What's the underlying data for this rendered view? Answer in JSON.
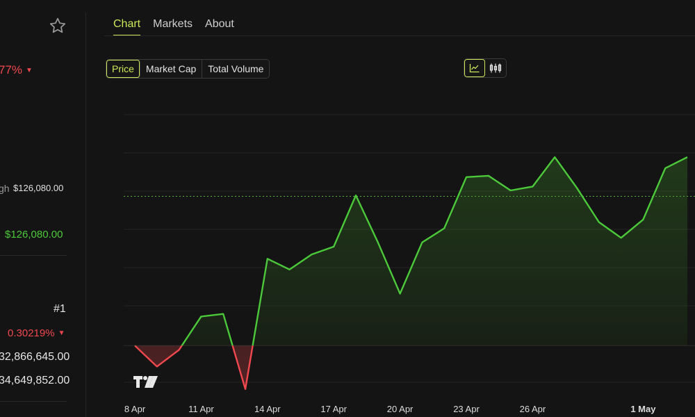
{
  "header": {
    "tabs": [
      {
        "label": "Chart",
        "active": true
      },
      {
        "label": "Markets",
        "active": false
      },
      {
        "label": "About",
        "active": false
      }
    ]
  },
  "controls": {
    "metric_tabs": [
      {
        "label": "Price",
        "active": true
      },
      {
        "label": "Market Cap",
        "active": false
      },
      {
        "label": "Total Volume",
        "active": false
      }
    ],
    "view_toggle": [
      {
        "icon": "line-chart-icon",
        "active": true
      },
      {
        "icon": "candlestick-icon",
        "active": false
      }
    ]
  },
  "left_panel": {
    "change_pct": "77%",
    "high_label": "gh",
    "high_value": "$126,080.00",
    "high_value_green": "$126,080.00",
    "rank": "#1",
    "dominance_pct": "0.30219%",
    "value_1": "32,866,645.00",
    "value_2": "34,649,852.00"
  },
  "colors": {
    "accent": "#cbe95b",
    "up": "#4cc93a",
    "down": "#f0484f",
    "background": "#141414"
  },
  "chart_data": {
    "type": "line",
    "title": "",
    "xlabel": "",
    "ylabel": "",
    "x_tick_labels": [
      "8 Apr",
      "11 Apr",
      "14 Apr",
      "17 Apr",
      "20 Apr",
      "23 Apr",
      "26 Apr",
      "1 May"
    ],
    "x_tick_days": [
      8,
      11,
      14,
      17,
      20,
      23,
      26,
      31
    ],
    "y_axis_labels_visible": false,
    "ylim": [
      0,
      100
    ],
    "baseline": 17.6,
    "reference_level": 63.3,
    "grid": "horizontal",
    "watermark": "TradingView logo",
    "series": [
      {
        "x": [
          8,
          9,
          10,
          11,
          12,
          13,
          14,
          15,
          16,
          17,
          18,
          19,
          20,
          21,
          22,
          23,
          24,
          25,
          26,
          27,
          28,
          29,
          30,
          31,
          32,
          33
        ],
        "values": [
          17.6,
          11.2,
          16.3,
          26.5,
          27.3,
          4.3,
          44.2,
          40.9,
          45.5,
          47.9,
          63.6,
          49.2,
          33.5,
          49.2,
          53.5,
          69.2,
          69.6,
          65.1,
          66.3,
          75.3,
          65.9,
          55.4,
          50.6,
          56.2,
          71.9,
          75.3
        ]
      }
    ]
  }
}
